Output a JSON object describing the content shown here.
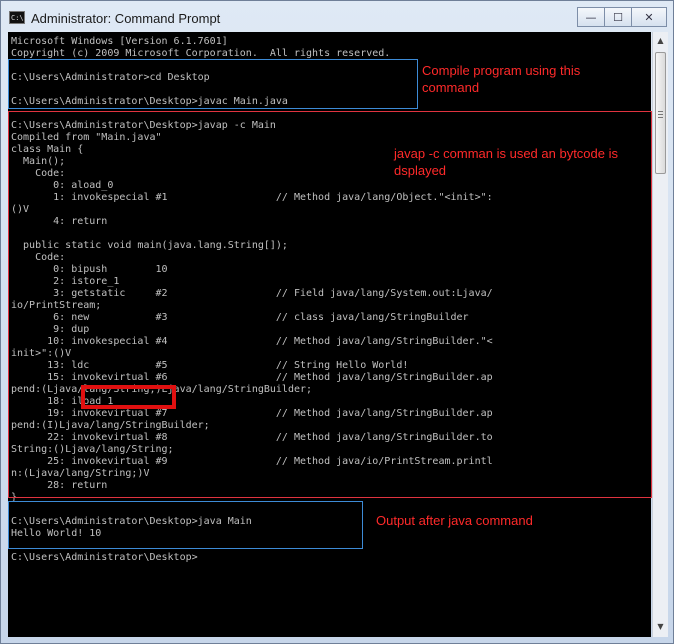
{
  "window": {
    "icon_label": "C:\\",
    "title": "Administrator: Command Prompt",
    "buttons": {
      "minimize": "—",
      "maximize": "☐",
      "close": "✕"
    }
  },
  "console": {
    "lines": [
      "Microsoft Windows [Version 6.1.7601]",
      "Copyright (c) 2009 Microsoft Corporation.  All rights reserved.",
      "",
      "C:\\Users\\Administrator>cd Desktop",
      "",
      "C:\\Users\\Administrator\\Desktop>javac Main.java",
      "",
      "C:\\Users\\Administrator\\Desktop>javap -c Main",
      "Compiled from \"Main.java\"",
      "class Main {",
      "  Main();",
      "    Code:",
      "       0: aload_0",
      "       1: invokespecial #1                  // Method java/lang/Object.\"<init>\":",
      "()V",
      "       4: return",
      "",
      "  public static void main(java.lang.String[]);",
      "    Code:",
      "       0: bipush        10",
      "       2: istore_1",
      "       3: getstatic     #2                  // Field java/lang/System.out:Ljava/",
      "io/PrintStream;",
      "       6: new           #3                  // class java/lang/StringBuilder",
      "       9: dup",
      "      10: invokespecial #4                  // Method java/lang/StringBuilder.\"<",
      "init>\":()V",
      "      13: ldc           #5                  // String Hello World!",
      "      15: invokevirtual #6                  // Method java/lang/StringBuilder.ap",
      "pend:(Ljava/lang/String;)Ljava/lang/StringBuilder;",
      "      18: iload_1",
      "      19: invokevirtual #7                  // Method java/lang/StringBuilder.ap",
      "pend:(I)Ljava/lang/StringBuilder;",
      "      22: invokevirtual #8                  // Method java/lang/StringBuilder.to",
      "String:()Ljava/lang/String;",
      "      25: invokevirtual #9                  // Method java/io/PrintStream.printl",
      "n:(Ljava/lang/String;)V",
      "      28: return",
      "}",
      "",
      "C:\\Users\\Administrator\\Desktop>java Main",
      "Hello World! 10",
      "",
      "C:\\Users\\Administrator\\Desktop>"
    ]
  },
  "annotations": {
    "compile_note": "Compile program using this command",
    "javap_note": "javap -c comman is used an bytcode is dsplayed",
    "output_note": "Output after java command"
  },
  "scrollbar": {
    "up_arrow": "▲",
    "down_arrow": "▼"
  }
}
